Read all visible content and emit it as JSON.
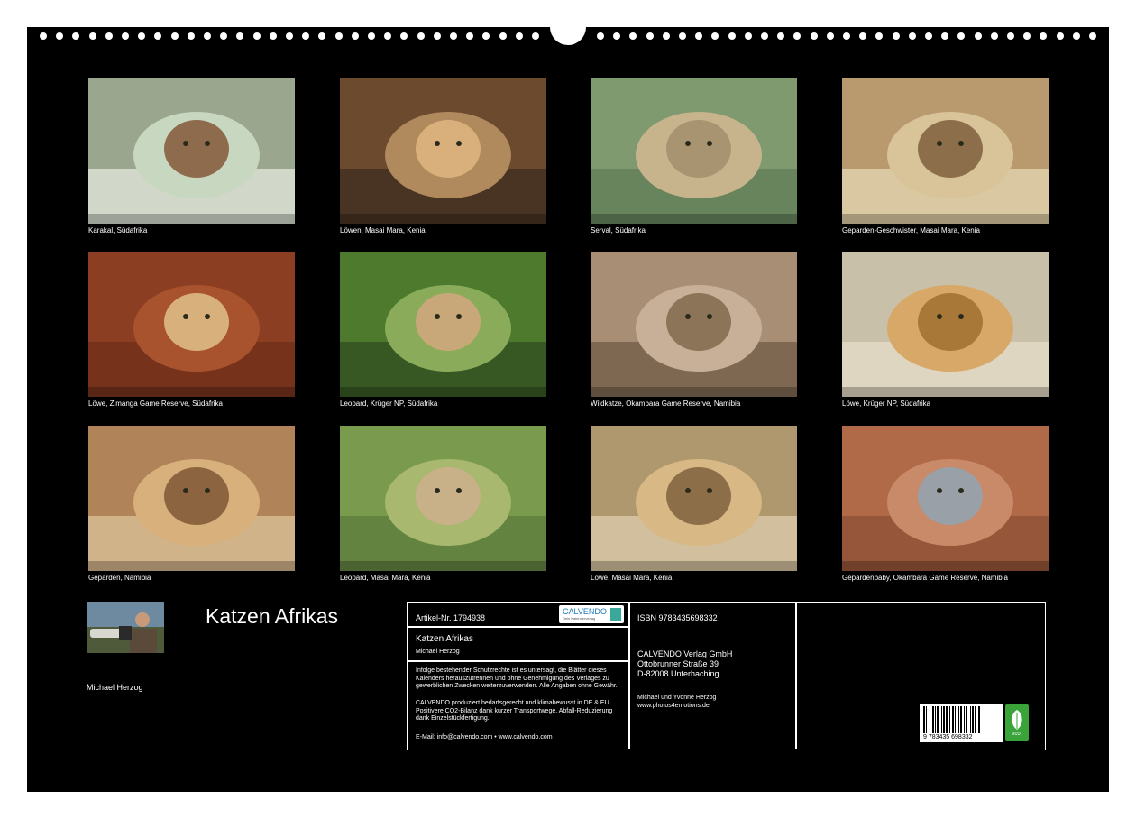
{
  "photos": [
    {
      "caption": "Karakal, Südafrika",
      "icon": "caracal-photo",
      "colors": [
        "#9aa78e",
        "#c8d8c0",
        "#8e6b4c",
        "#e8ece4"
      ]
    },
    {
      "caption": "Löwen, Masai Mara, Kenia",
      "icon": "lion-photo",
      "colors": [
        "#6b4a2e",
        "#b0895c",
        "#d9b07c",
        "#3a2a1e"
      ]
    },
    {
      "caption": "Serval, Südafrika",
      "icon": "serval-photo",
      "colors": [
        "#7f9a6e",
        "#c8b48c",
        "#a89470",
        "#5d7a55"
      ]
    },
    {
      "caption": "Geparden-Geschwister, Masai Mara, Kenia",
      "icon": "cheetah-cubs-photo",
      "colors": [
        "#b89a6e",
        "#d8c498",
        "#8c6e4a",
        "#e8dcb8"
      ]
    },
    {
      "caption": "Löwe, Zimanga Game Reserve, Südafrika",
      "icon": "lion-cub-photo",
      "colors": [
        "#8c3e22",
        "#a8522e",
        "#d8b07c",
        "#6e2e18"
      ]
    },
    {
      "caption": "Leopard, Krüger NP, Südafrika",
      "icon": "leopard-photo",
      "colors": [
        "#4e7a2e",
        "#8aac5a",
        "#c8a878",
        "#2e4a1e"
      ]
    },
    {
      "caption": "Wildkatze, Okambara Game Reserve, Namibia",
      "icon": "wildcat-photo",
      "colors": [
        "#a88e74",
        "#c8b098",
        "#8c7458",
        "#6e5844"
      ]
    },
    {
      "caption": "Löwe, Krüger NP, Südafrika",
      "icon": "lion-male-photo",
      "colors": [
        "#c8c0a8",
        "#d8a868",
        "#a87838",
        "#e8e0cc"
      ]
    },
    {
      "caption": "Geparden, Namibia",
      "icon": "cheetahs-photo",
      "colors": [
        "#b08458",
        "#d8b07c",
        "#8c6440",
        "#e0c8a0"
      ]
    },
    {
      "caption": "Leopard, Masai Mara, Kenia",
      "icon": "leopard-cub-photo",
      "colors": [
        "#7a9a4e",
        "#a8b86e",
        "#c8b088",
        "#5a7a3a"
      ]
    },
    {
      "caption": "Löwe, Masai Mara, Kenia",
      "icon": "lion-resting-photo",
      "colors": [
        "#b0986e",
        "#d8b884",
        "#8c6e48",
        "#e0d0b0"
      ]
    },
    {
      "caption": "Gepardenbaby, Okambara Game Reserve, Namibia",
      "icon": "cheetah-baby-photo",
      "colors": [
        "#b06a48",
        "#c88a68",
        "#9aa0a8",
        "#8c4e34"
      ]
    }
  ],
  "title": "Katzen Afrikas",
  "author": "Michael Herzog",
  "info": {
    "artikel": "Artikel-Nr. 1794938",
    "logo_text": "CALVENDO",
    "logo_sub": "Dein Kalenderverlag",
    "book_title": "Katzen Afrikas",
    "book_author": "Michael Herzog",
    "legal_text": "Infolge bestehender Schutzrechte ist es untersagt, die Blätter dieses Kalenders herauszutrennen und ohne Genehmigung des Verlages zu gewerblichen Zwecken weiterzuverwenden. Alle Angaben ohne Gewähr.",
    "eco_text": "CALVENDO produziert bedarfsgerecht und klimabewusst in DE & EU. Positivere CO2-Bilanz dank kurzer Transportwege. Abfall-Reduzierung dank Einzelstückfertigung.",
    "contact": "E-Mail: info@calvendo.com • www.calvendo.com",
    "isbn": "ISBN 9783435698332",
    "publisher_name": "CALVENDO Verlag GmbH",
    "publisher_street": "Ottobrunner Straße 39",
    "publisher_city": "D-82008 Unterhaching",
    "photographers": "Michael und Yvonne Herzog",
    "website": "www.photos4emotions.de",
    "barcode_number": "9 783435 698332",
    "eco_label": "eco"
  }
}
